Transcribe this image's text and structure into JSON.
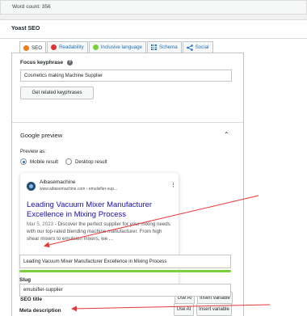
{
  "word_count": "Word count: 356",
  "panel_title": "Yoast SEO",
  "tabs": [
    {
      "label": "SEO",
      "icon": "seo-score-icon",
      "color": "#ee7c1b"
    },
    {
      "label": "Readability",
      "icon": "readability-score-icon",
      "color": "#dc3232"
    },
    {
      "label": "Inclusive language",
      "icon": "inclusive-language-icon",
      "color": "#7ad03a"
    },
    {
      "label": "Schema",
      "icon": "schema-grid-icon",
      "color": "#2271b1"
    },
    {
      "label": "Social",
      "icon": "share-icon",
      "color": "#2271b1"
    }
  ],
  "focus_keyphrase": {
    "label": "Focus keyphrase",
    "help_icon": "?",
    "value": "Cosmetics making Machine Supplier",
    "related_button": "Get related keyphrases"
  },
  "google_preview": {
    "title": "Google preview",
    "preview_as_label": "Preview as:",
    "options": [
      "Mobile result",
      "Desktop result"
    ],
    "selected": "Mobile result",
    "card": {
      "site_name": "Aibasemachine",
      "url": "www.aibasemachine.com › emulsifier-sup...",
      "title": "Leading Vacuum Mixer Manufacturer Excellence in Mixing Process",
      "date": "Mar 5, 2023",
      "description": "Discover the perfect supplier for your mixing needs with our top-rated blending machine manufacturer. From high shear mixers to emulsion mixers, we ..."
    }
  },
  "seo_title": {
    "label": "SEO title",
    "use_ai": "Use AI",
    "insert_variable": "Insert variable",
    "value": "Leading Vacuum Mixer Manufacturer Excellence in Mixing Process",
    "progress": 1.0,
    "progress_color": "#7ad03a"
  },
  "slug": {
    "label": "Slug",
    "value": "emulsifier-supplier"
  },
  "meta_description": {
    "label": "Meta description",
    "use_ai": "Use AI",
    "insert_variable": "Insert variable"
  },
  "annotation_color": "#e53935"
}
